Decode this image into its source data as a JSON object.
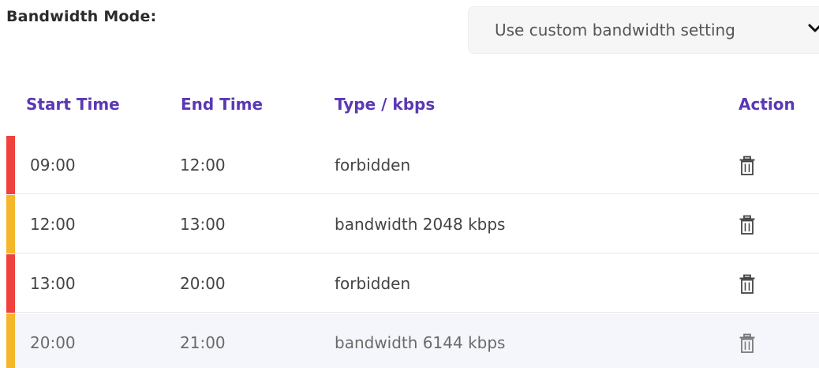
{
  "bandwidth_mode": {
    "label": "Bandwidth Mode:",
    "selected_value": "Use custom bandwidth setting"
  },
  "table": {
    "headers": {
      "start_time": "Start Time",
      "end_time": "End Time",
      "type": "Type / kbps",
      "action": "Action"
    },
    "rows": [
      {
        "start": "09:00",
        "end": "12:00",
        "type": "forbidden",
        "stripe_color": "#f0413c",
        "action_icon": "trash-icon"
      },
      {
        "start": "12:00",
        "end": "13:00",
        "type": "bandwidth 2048 kbps",
        "stripe_color": "#f5b72a",
        "action_icon": "trash-icon"
      },
      {
        "start": "13:00",
        "end": "20:00",
        "type": "forbidden",
        "stripe_color": "#f0413c",
        "action_icon": "trash-icon"
      },
      {
        "start": "20:00",
        "end": "21:00",
        "type": "bandwidth 6144 kbps",
        "stripe_color": "#f5b72a",
        "action_icon": "trash-icon"
      }
    ]
  },
  "colors": {
    "header_text": "#5a38b4",
    "forbidden_stripe": "#f0413c",
    "bandwidth_stripe": "#f5b72a"
  }
}
